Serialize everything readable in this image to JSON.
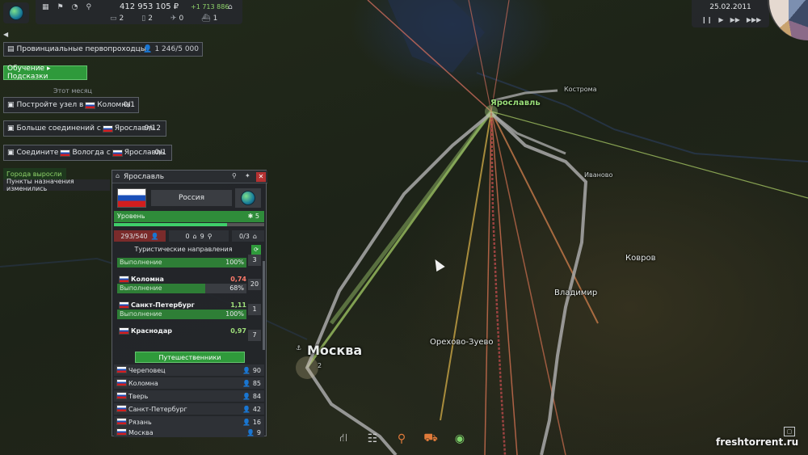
{
  "topbar": {
    "money": "412 953 105 ₽",
    "money_delta": "+1 713 886",
    "counts": [
      {
        "icon": "bus-icon",
        "value": "2"
      },
      {
        "icon": "train-icon",
        "value": "2"
      },
      {
        "icon": "plane-icon",
        "value": "0"
      },
      {
        "icon": "ship-icon",
        "value": "1"
      }
    ]
  },
  "date_panel": {
    "date": "25.02.2011",
    "speed_controls": [
      "❙❙",
      "▶",
      "▶▶",
      "▶▶▶"
    ]
  },
  "quests": {
    "main": {
      "label": "Провинциальные первопроходцы",
      "progress": "1 246/5 000"
    },
    "tutorial_button": "Обучение ▸ Подсказки",
    "month_label": "Этот месяц",
    "tasks": [
      {
        "prefix": "Постройте узел в",
        "city": "Коломна",
        "progress": "0/1"
      },
      {
        "prefix": "Больше соединений с",
        "city": "Ярославль",
        "progress": "9/12"
      },
      {
        "prefix": "Соедините",
        "city": "Вологда",
        "mid": "с",
        "city2": "Ярославль",
        "progress": "0/1"
      }
    ]
  },
  "notices": [
    {
      "text": "Города выросли",
      "color": "#8fd46a"
    },
    {
      "text": "Пункты назначения изменились",
      "color": "#dfe2e5"
    }
  ],
  "city_panel": {
    "title": "Ярославль",
    "country": "Россия",
    "level_label": "Уровень",
    "level_value": "5",
    "level_progress": 0.75,
    "stats": {
      "population": "293/540",
      "stations": "0",
      "stops": "9",
      "depots": "0/3"
    },
    "destinations_title": "Туристические направления",
    "first_row": {
      "label": "Выполнение",
      "pct": "100%",
      "fill": 1.0,
      "count": "3"
    },
    "destinations": [
      {
        "name": "Коломна",
        "value": "0,74",
        "value_color": "red",
        "label": "Выполнение",
        "pct": "68%",
        "fill": 0.68,
        "count": "20"
      },
      {
        "name": "Санкт-Петербург",
        "value": "1,11",
        "value_color": "green",
        "label": "Выполнение",
        "pct": "100%",
        "fill": 1.0,
        "count": "1"
      },
      {
        "name": "Краснодар",
        "value": "0,97",
        "value_color": "green",
        "label": "",
        "pct": "",
        "fill": 0.0,
        "count": "7"
      }
    ],
    "travelers_button": "Путешественники",
    "travelers": [
      {
        "name": "Череповец",
        "count": "90"
      },
      {
        "name": "Коломна",
        "count": "85"
      },
      {
        "name": "Тверь",
        "count": "84"
      },
      {
        "name": "Санкт-Петербург",
        "count": "42"
      },
      {
        "name": "Рязань",
        "count": "16"
      },
      {
        "name": "Москва",
        "count": "9"
      }
    ]
  },
  "map_labels": {
    "kostroma": "Кострома",
    "yaroslavl": "Ярославль",
    "ivanovo": "Иваново",
    "kovrov": "Ковров",
    "vladimir": "Владимир",
    "orekhovo": "Орехово-Зуево",
    "moscow": "Москва",
    "moscow_level": "2"
  },
  "bottom_tools": [
    "road-icon",
    "rail-icon",
    "route-pin-icon",
    "bulldozer-icon",
    "eye-icon"
  ],
  "watermark": "freshtorrent.ru"
}
